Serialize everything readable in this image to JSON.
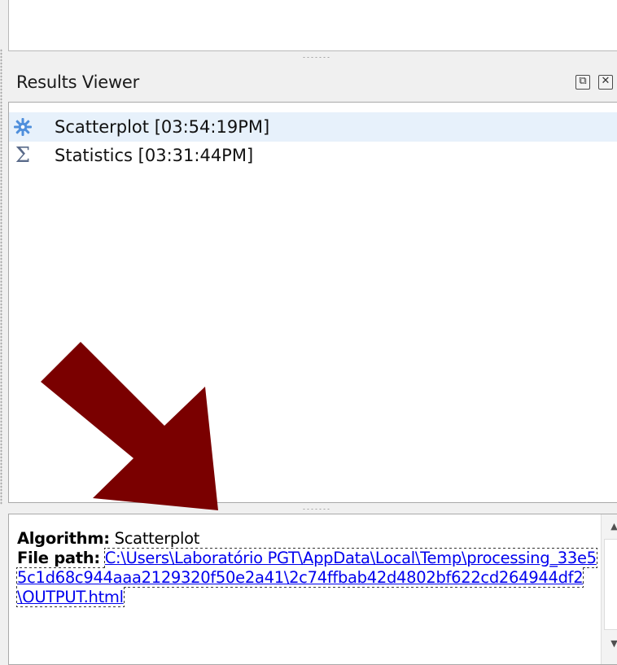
{
  "panel": {
    "title": "Results Viewer",
    "float_button": "⧉",
    "close_button": "✕"
  },
  "results": [
    {
      "label": "Scatterplot [03:54:19PM]",
      "icon": "gear-icon",
      "selected": true
    },
    {
      "label": "Statistics [03:31:44PM]",
      "icon": "sigma-icon",
      "selected": false
    }
  ],
  "details": {
    "algorithm_label": "Algorithm:",
    "algorithm_value": " Scatterplot",
    "file_path_label": "File path:",
    "file_path_value": "C:\\Users\\Laboratório PGT\\AppData\\Local\\Temp\\processing_33e55c1d68c944aaa2129320f50e2a41\\2c74ffbab42d4802bf622cd264944df2\\OUTPUT.html"
  },
  "scrollbar": {
    "up_arrow": "▲",
    "down_arrow": "▼"
  },
  "colors": {
    "arrow": "#7a0000",
    "link": "#0000ee",
    "gear_icon": "#4f8fdc"
  }
}
